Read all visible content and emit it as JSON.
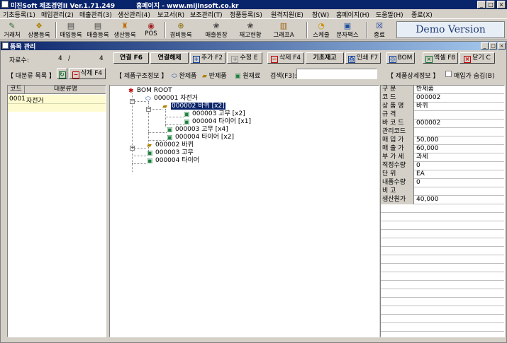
{
  "window": {
    "title": "미진Soft 제조경영II Ver.1.71.249",
    "homepage": "홈페이지 - www.mijinsoft.co.kr",
    "controls": [
      "_",
      "□",
      "×"
    ]
  },
  "menu": [
    "기초등록(1)",
    "매입관리(2)",
    "매출관리(3)",
    "생산관리(4)",
    "보고서(R)",
    "보조관리(T)",
    "정품등록(S)",
    "원격지원(E)",
    "창(W)",
    "홈페이지(H)",
    "도움말(H)",
    "종료(X)"
  ],
  "toolbar": [
    {
      "label": "거래처",
      "icon": "address-book-icon"
    },
    {
      "label": "상품등록",
      "icon": "product-icon"
    },
    {
      "label": "매입등록",
      "icon": "purchase-icon"
    },
    {
      "label": "매출등록",
      "icon": "sales-icon"
    },
    {
      "label": "생산등록",
      "icon": "production-icon"
    },
    {
      "label": "POS",
      "icon": "pos-icon"
    },
    {
      "label": "경비등록",
      "icon": "expense-icon"
    },
    {
      "label": "매출원장",
      "icon": "ledger-icon"
    },
    {
      "label": "재고현황",
      "icon": "inventory-icon"
    },
    {
      "label": "그래프A",
      "icon": "graph-icon"
    },
    {
      "label": "스케줄",
      "icon": "schedule-icon"
    },
    {
      "label": "문자팩스",
      "icon": "sms-fax-icon"
    },
    {
      "label": "종료",
      "icon": "exit-icon"
    }
  ],
  "demo_label": "Demo Version",
  "child": {
    "title": "품목 관리",
    "controls": [
      "_",
      "□",
      "×"
    ]
  },
  "record": {
    "label": "자료수:",
    "current": "4",
    "separator": "/",
    "total": "4"
  },
  "actions": {
    "connect": "연결 F6",
    "disconnect": "연결해제",
    "add": "추가 F2",
    "edit": "수정 E",
    "delete": "삭제 F4",
    "base_stock": "기초재고",
    "print": "인쇄 F7",
    "bom": "BOM",
    "excel": "엑셀 F8",
    "close": "닫기 C"
  },
  "category_bar": {
    "title": "【 대분류 목록 】",
    "delete": "삭제 F4"
  },
  "structure_bar": {
    "title": "【 제품구조정보 】",
    "finished": "완제품",
    "semi": "반제품",
    "raw": "원재료",
    "search_label": "검색(F3):",
    "search_value": ""
  },
  "detail_bar": {
    "title": "【 제품상세정보 】",
    "hide_price": "매입가 숨김(B)"
  },
  "category_table": {
    "headers": [
      "코드",
      "대분류명"
    ],
    "rows": [
      [
        "0001",
        "자전거"
      ]
    ]
  },
  "tree": [
    {
      "text": "BOM ROOT",
      "level": 0,
      "icon": "bom-root-icon"
    },
    {
      "text": "000001 자전거",
      "level": 1,
      "icon": "finished-product-icon"
    },
    {
      "text": "000002 바퀴 [x2]",
      "level": 2,
      "icon": "semi-product-icon",
      "selected": true
    },
    {
      "text": "000003 고무 [x2]",
      "level": 3,
      "icon": "raw-material-icon"
    },
    {
      "text": "000004 타이어 [x1]",
      "level": 3,
      "icon": "raw-material-icon"
    },
    {
      "text": "000003 고무 [x4]",
      "level": 2,
      "icon": "raw-material-icon"
    },
    {
      "text": "000004 타이어 [x2]",
      "level": 2,
      "icon": "raw-material-icon"
    },
    {
      "text": "000002 바퀴",
      "level": 1,
      "icon": "semi-product-icon"
    },
    {
      "text": "000003 고무",
      "level": 1,
      "icon": "raw-material-icon"
    },
    {
      "text": "000004 타이어",
      "level": 1,
      "icon": "raw-material-icon"
    }
  ],
  "detail": [
    {
      "key": "구   분",
      "value": "반제품"
    },
    {
      "key": "코   드",
      "value": "000002"
    },
    {
      "key": "상 품 명",
      "value": "바퀴"
    },
    {
      "key": "규   격",
      "value": ""
    },
    {
      "key": "바 코 드",
      "value": "000002"
    },
    {
      "key": "관리코드",
      "value": ""
    },
    {
      "key": "매 입 가",
      "value": "50,000"
    },
    {
      "key": "매 출 가",
      "value": "60,000"
    },
    {
      "key": "부 가 세",
      "value": "과세"
    },
    {
      "key": "적정수량",
      "value": "0"
    },
    {
      "key": "단   위",
      "value": "EA"
    },
    {
      "key": "내품수량",
      "value": "0"
    },
    {
      "key": "비   고",
      "value": ""
    },
    {
      "key": "생산원가",
      "value": "40,000"
    }
  ]
}
